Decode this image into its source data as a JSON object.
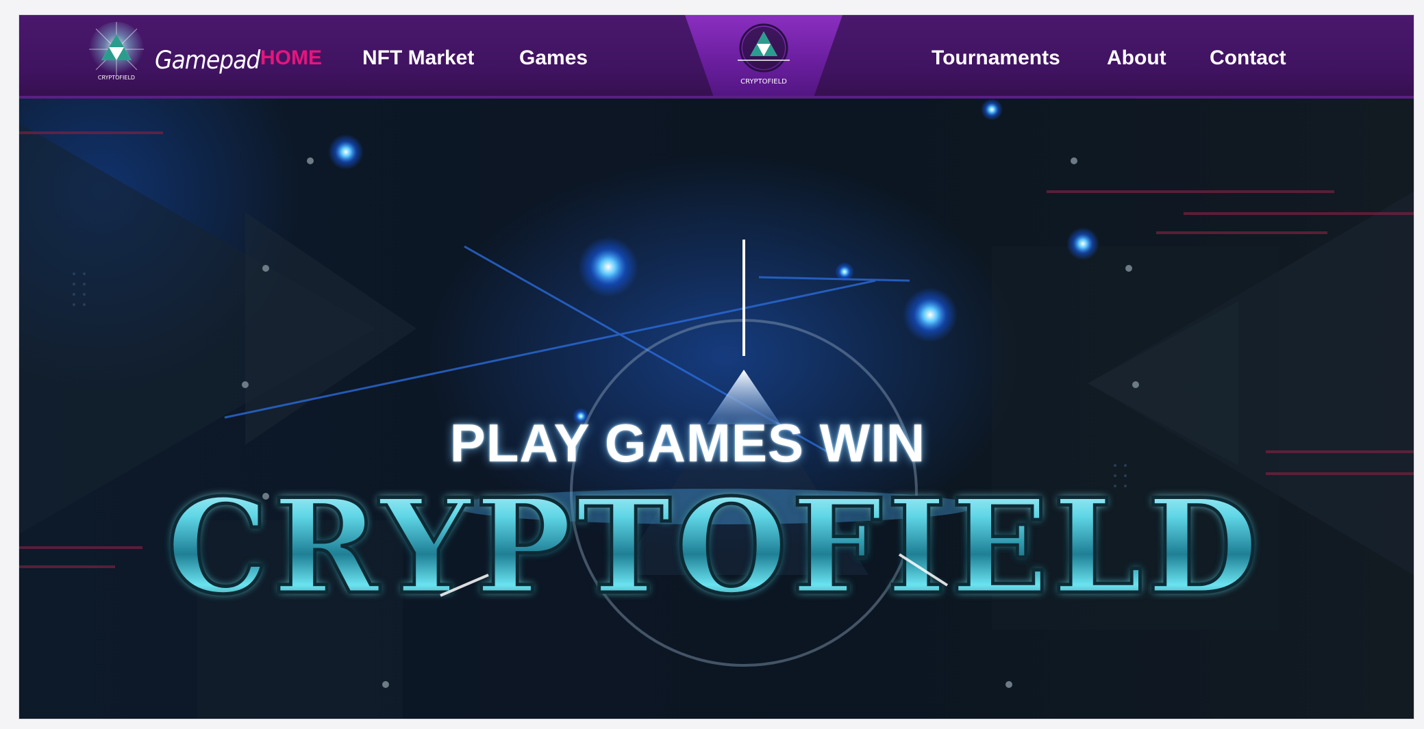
{
  "brand": {
    "name": "Gamepad",
    "logo_text": "CRYPTOFIELD"
  },
  "nav": {
    "left": [
      {
        "label": "HOME",
        "active": true
      },
      {
        "label": "NFT Market",
        "active": false
      },
      {
        "label": "Games",
        "active": false
      }
    ],
    "center_logo_text": "CRYPTOFIELD",
    "right": [
      {
        "label": "Tournaments",
        "active": false
      },
      {
        "label": "About",
        "active": false
      },
      {
        "label": "Contact",
        "active": false
      }
    ]
  },
  "hero": {
    "tagline": "PLAY GAMES WIN",
    "title": "CRYPTOFIELD"
  },
  "colors": {
    "nav_bg": "#4a186d",
    "active_link": "#e5157c",
    "center_tab": "#7a26b0",
    "title_cyan": "#5fd6e6"
  }
}
